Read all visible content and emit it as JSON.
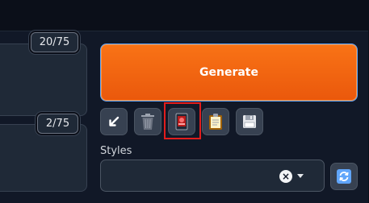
{
  "prompt_counter": "20/75",
  "negative_counter": "2/75",
  "generate_label": "Generate",
  "styles_label": "Styles",
  "styles_clear": "×",
  "tool_buttons": [
    {
      "icon": "arrow-down-left-icon"
    },
    {
      "icon": "trash-icon"
    },
    {
      "icon": "red-card-icon"
    },
    {
      "icon": "clipboard-icon"
    },
    {
      "icon": "save-icon"
    }
  ],
  "colors": {
    "generate_bg": "#ea580c",
    "highlight": "#e11d1d",
    "background": "#0b0f19"
  }
}
